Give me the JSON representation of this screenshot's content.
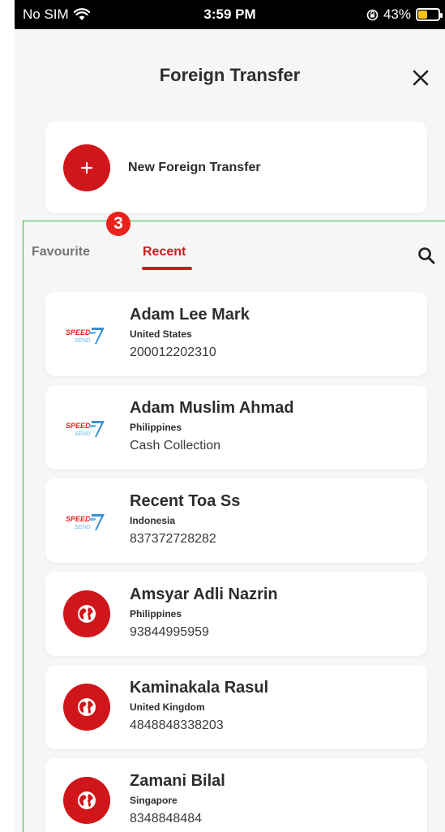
{
  "status_bar": {
    "carrier": "No SIM",
    "time": "3:59 PM",
    "battery": "43%"
  },
  "header": {
    "title": "Foreign Transfer"
  },
  "new_transfer": {
    "label": "New Foreign Transfer"
  },
  "tabs": {
    "favourite": "Favourite",
    "recent": "Recent",
    "active": "recent"
  },
  "annotation_badge": "3",
  "recipients": [
    {
      "name": "Adam Lee Mark",
      "country": "United States",
      "detail": "200012202310",
      "logo": "speedsend-logo"
    },
    {
      "name": "Adam Muslim Ahmad",
      "country": "Philippines",
      "detail": "Cash Collection",
      "logo": "speedsend-logo"
    },
    {
      "name": "Recent Toa Ss",
      "country": "Indonesia",
      "detail": "837372728282",
      "logo": "speedsend-logo"
    },
    {
      "name": "Amsyar Adli Nazrin",
      "country": "Philippines",
      "detail": "93844995959",
      "logo": "globe-icon"
    },
    {
      "name": "Kaminakala Rasul",
      "country": "United Kingdom",
      "detail": "4848848338203",
      "logo": "globe-icon"
    },
    {
      "name": "Zamani Bilal",
      "country": "Singapore",
      "detail": "8348848484",
      "logo": "globe-icon"
    }
  ],
  "logo_text": {
    "speed": "SPEED",
    "send": "SEND"
  },
  "colors": {
    "accent": "#d0161b",
    "badge": "#e8221d",
    "frame": "#39b54a",
    "background": "#f6f6f6"
  }
}
